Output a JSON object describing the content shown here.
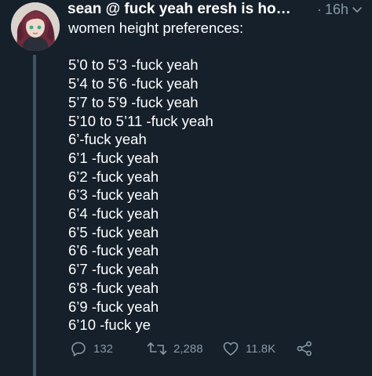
{
  "tweet": {
    "author": "sean @ fuck yeah eresh is home ...",
    "separator": "·",
    "time": "16h",
    "lines": [
      "women height preferences:",
      "",
      "5’0 to 5’3 -fuck yeah",
      "5’4 to 5’6 -fuck yeah",
      "5’7 to 5’9 -fuck yeah",
      "5’10 to 5’11 -fuck yeah",
      "6’-fuck yeah",
      "6’1 -fuck yeah",
      "6’2 -fuck yeah",
      "6’3 -fuck yeah",
      "6’4 -fuck yeah",
      "6’5 -fuck yeah",
      "6’6 -fuck yeah",
      "6’7 -fuck yeah",
      "6’8 -fuck yeah",
      "6’9 -fuck yeah",
      "6’10 -fuck ye"
    ]
  },
  "actions": {
    "replies": "132",
    "retweets": "2,288",
    "likes": "11.8K"
  },
  "icons": {
    "reply": "reply-icon",
    "retweet": "retweet-icon",
    "like": "heart-icon",
    "share": "share-icon",
    "menu": "chevron-down-icon"
  },
  "colors": {
    "background": "#15202b",
    "text": "#ffffff",
    "muted": "#8899a6",
    "thread_line": "#3d5466"
  }
}
